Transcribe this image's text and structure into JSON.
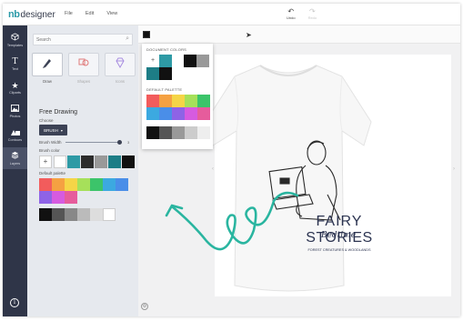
{
  "app": {
    "logo_mark": "nb",
    "logo_text": "designer",
    "menu": [
      "File",
      "Edit",
      "View"
    ],
    "undo_label": "Undo",
    "redo_label": "Redo"
  },
  "rail": [
    {
      "label": "Templates",
      "icon": "cube-icon"
    },
    {
      "label": "Text",
      "icon": "text-icon"
    },
    {
      "label": "Cliparts",
      "icon": "star-icon"
    },
    {
      "label": "Photos",
      "icon": "photo-icon"
    },
    {
      "label": "Contours",
      "icon": "shapes-icon"
    },
    {
      "label": "Layers",
      "icon": "layers-icon"
    }
  ],
  "panel": {
    "search_placeholder": "Search",
    "tools": [
      {
        "label": "Draw",
        "icon": "marker-icon"
      },
      {
        "label": "Shapes",
        "icon": "shapes-icon"
      },
      {
        "label": "Icons",
        "icon": "gem-icon"
      }
    ],
    "title": "Free Drawing",
    "choose_label": "Choose",
    "brush_label": "BRUSH",
    "brush_width_label": "Brush Width",
    "brush_width_value": "3",
    "brush_color_label": "Brush color",
    "default_palette_label": "Default palette",
    "brush_colors": [
      "#ffffff",
      "#2e9aa5",
      "#2c2c2c",
      "#999999",
      "#1d7d86",
      "#111111"
    ],
    "palette_row1": [
      "#f25c5c",
      "#f5a142",
      "#f5d547",
      "#a6e05a",
      "#3cc46a",
      "#3ca9e0",
      "#4a8ee8"
    ],
    "palette_row2": [
      "#8e63e6",
      "#d65be0",
      "#e65c9c"
    ],
    "grays": [
      "#111111",
      "#555555",
      "#888888",
      "#bbbbbb",
      "#dddddd",
      "#ffffff"
    ]
  },
  "canvas": {
    "current_color": "#111111"
  },
  "design": {
    "bedtime": "Bedtime",
    "fairy": "FAIRY",
    "stories": "STORIES",
    "subtitle": "FOREST CREATURES & WOODLANDS"
  },
  "popup": {
    "document_colors_label": "DOCUMENT COLORS",
    "default_palette_label": "DEFAULT PALETTE",
    "document_colors": [
      "#2e9aa5",
      "#1d7d86",
      "#111111",
      "#111111",
      "#999999"
    ],
    "palette_row1": [
      "#f25c5c",
      "#f5a142",
      "#f5d547",
      "#a6e05a",
      "#3cc46a"
    ],
    "palette_row2": [
      "#3ca9e0",
      "#4a8ee8",
      "#8e63e6",
      "#d65be0",
      "#e65c9c"
    ],
    "grays": [
      "#111111",
      "#555555",
      "#999999",
      "#cccccc",
      "#eeeeee"
    ]
  },
  "colors": {
    "accent_teal": "#2ab5a0",
    "rail_bg": "#2f3548",
    "panel_bg": "#e6e9ee",
    "navy_text": "#2b3350"
  }
}
